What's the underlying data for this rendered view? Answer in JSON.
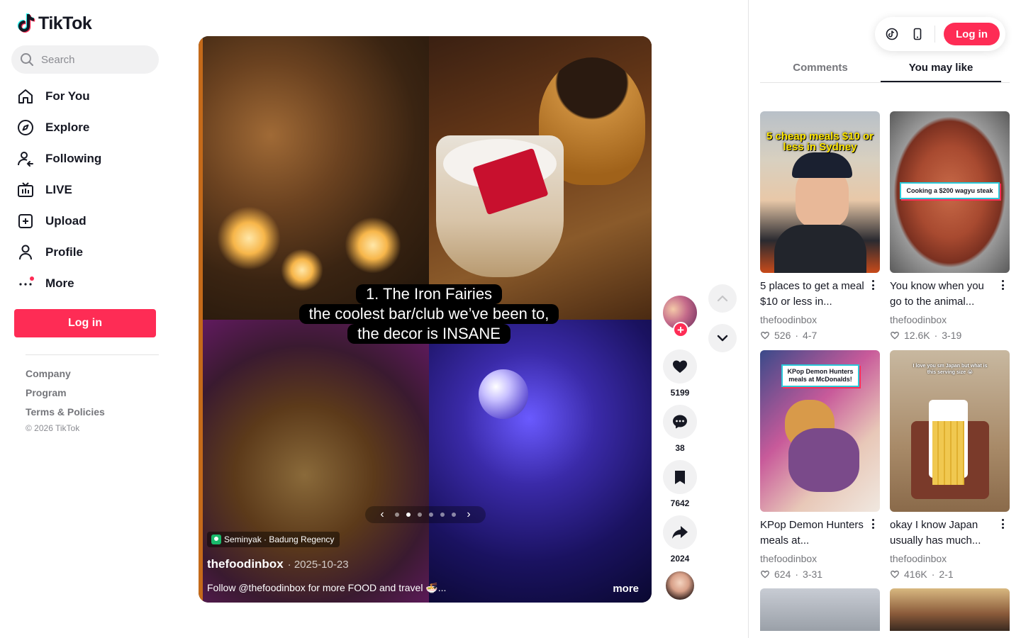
{
  "app": {
    "logo_text": "TikTok"
  },
  "search": {
    "placeholder": "Search"
  },
  "nav": [
    {
      "label": "For You",
      "icon": "home-icon"
    },
    {
      "label": "Explore",
      "icon": "compass-icon"
    },
    {
      "label": "Following",
      "icon": "following-icon"
    },
    {
      "label": "LIVE",
      "icon": "live-icon"
    },
    {
      "label": "Upload",
      "icon": "upload-icon"
    },
    {
      "label": "Profile",
      "icon": "profile-icon"
    },
    {
      "label": "More",
      "icon": "more-icon"
    }
  ],
  "sidebar": {
    "login_label": "Log in",
    "footer_links": [
      "Company",
      "Program",
      "Terms & Policies"
    ],
    "copyright": "© 2026 TikTok"
  },
  "video": {
    "caption_lines": [
      "1. The Iron Fairies",
      "the coolest bar/club we’ve been to,",
      "the decor is INSANE"
    ],
    "location": "Seminyak · Badung Regency",
    "author": "thefoodinbox",
    "date": "· 2025-10-23",
    "description": "Follow @thefoodinbox for more FOOD and travel 🍜...",
    "more_label": "more",
    "slides_total": 6,
    "slide_active": 2
  },
  "actions": {
    "likes": "5199",
    "comments": "38",
    "saves": "7642",
    "shares": "2024",
    "follow_symbol": "+"
  },
  "right_panel": {
    "login_label": "Log in",
    "tabs": [
      "Comments",
      "You may like"
    ],
    "active_tab": 1,
    "cards": [
      {
        "title": "5 places to get a meal $10 or less in...",
        "author": "thefoodinbox",
        "likes": "526",
        "date": "4-7",
        "thumb_text": "5 cheap meals $10 or less in Sydney"
      },
      {
        "title": "You know when you go to the animal...",
        "author": "thefoodinbox",
        "likes": "12.6K",
        "date": "3-19",
        "thumb_text": "Cooking a $200 wagyu steak"
      },
      {
        "title": "KPop Demon Hunters meals at...",
        "author": "thefoodinbox",
        "likes": "624",
        "date": "3-31",
        "thumb_text": "KPop Demon Hunters meals at McDonalds!"
      },
      {
        "title": "okay I know Japan usually has much...",
        "author": "thefoodinbox",
        "likes": "416K",
        "date": "2-1",
        "thumb_text": "I love you sm Japan but what is this serving size 😭"
      }
    ]
  },
  "colors": {
    "accent": "#fe2c55",
    "text": "#161823",
    "muted": "#75767b"
  }
}
